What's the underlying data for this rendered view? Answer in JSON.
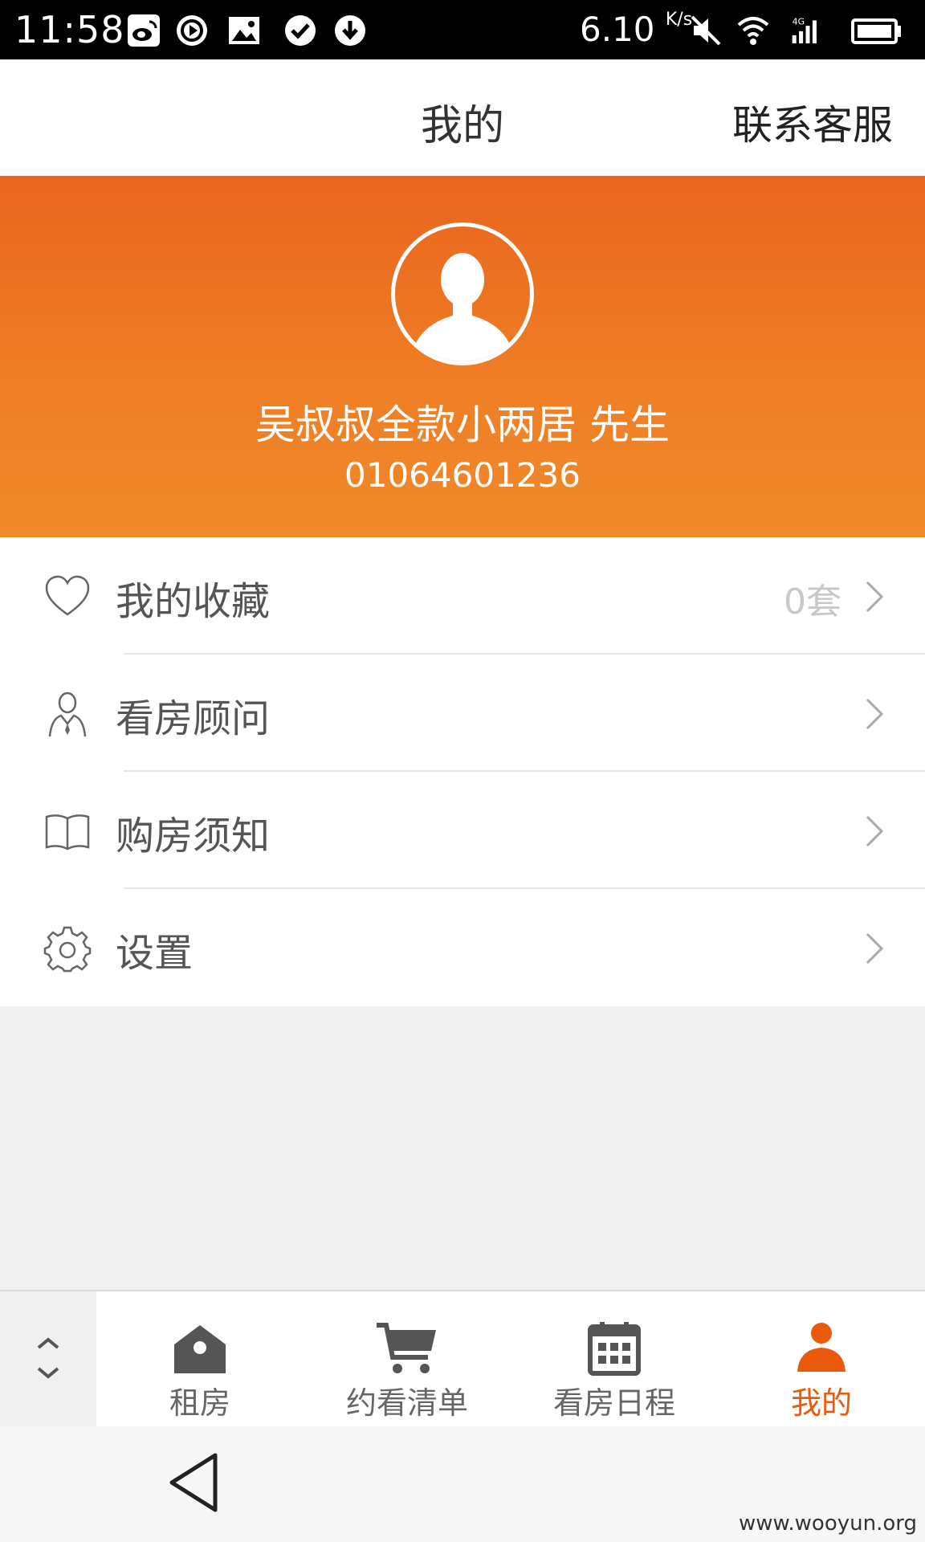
{
  "status_bar": {
    "time": "11:58",
    "speed_value": "6.10",
    "speed_unit": "K/s",
    "network": "4G",
    "icons": [
      "weibo-icon",
      "media-icon",
      "gallery-icon",
      "check-icon",
      "download-icon",
      "mute-icon",
      "wifi-icon",
      "signal-icon",
      "battery-icon"
    ]
  },
  "header": {
    "title": "我的",
    "contact_label": "联系客服"
  },
  "profile": {
    "name": "吴叔叔全款小两居 先生",
    "phone": "01064601236",
    "accent_color": "#ed7322"
  },
  "menu": {
    "items": [
      {
        "icon": "heart-icon",
        "label": "我的收藏",
        "value": "0套"
      },
      {
        "icon": "advisor-icon",
        "label": "看房顾问",
        "value": ""
      },
      {
        "icon": "book-icon",
        "label": "购房须知",
        "value": ""
      },
      {
        "icon": "gear-icon",
        "label": "设置",
        "value": ""
      }
    ]
  },
  "tabbar": {
    "active_color": "#e95a0c",
    "items": [
      {
        "icon": "house-icon",
        "label": "租房"
      },
      {
        "icon": "cart-icon",
        "label": "约看清单"
      },
      {
        "icon": "calendar-icon",
        "label": "看房日程"
      },
      {
        "icon": "person-icon",
        "label": "我的",
        "active": true
      }
    ]
  },
  "watermark": "www.wooyun.org"
}
